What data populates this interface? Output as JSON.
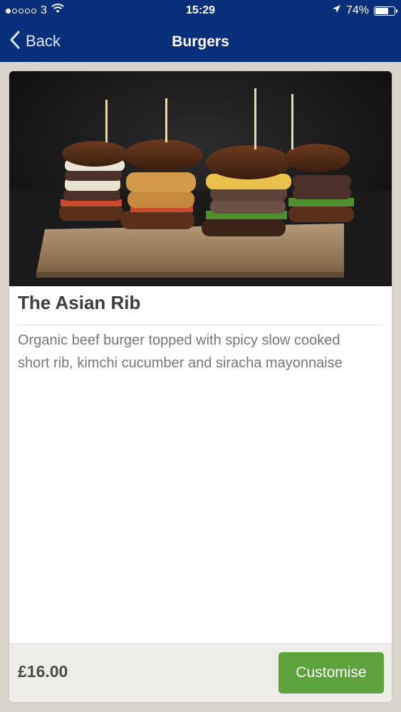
{
  "status_bar": {
    "carrier": "3",
    "time": "15:29",
    "battery": "74%",
    "battery_level": 0.74,
    "signal_bars": 1
  },
  "nav": {
    "back_label": "Back",
    "title": "Burgers"
  },
  "item": {
    "name": "The Asian Rib",
    "description": "Organic beef burger topped with spicy slow cooked short rib, kimchi cucumber and siracha mayonnaise",
    "price": "£16.00",
    "customise_label": "Customise"
  },
  "colors": {
    "nav_background": "#0a2f7a",
    "accent_button": "#5ba33a",
    "page_background": "#d9d5cc"
  }
}
